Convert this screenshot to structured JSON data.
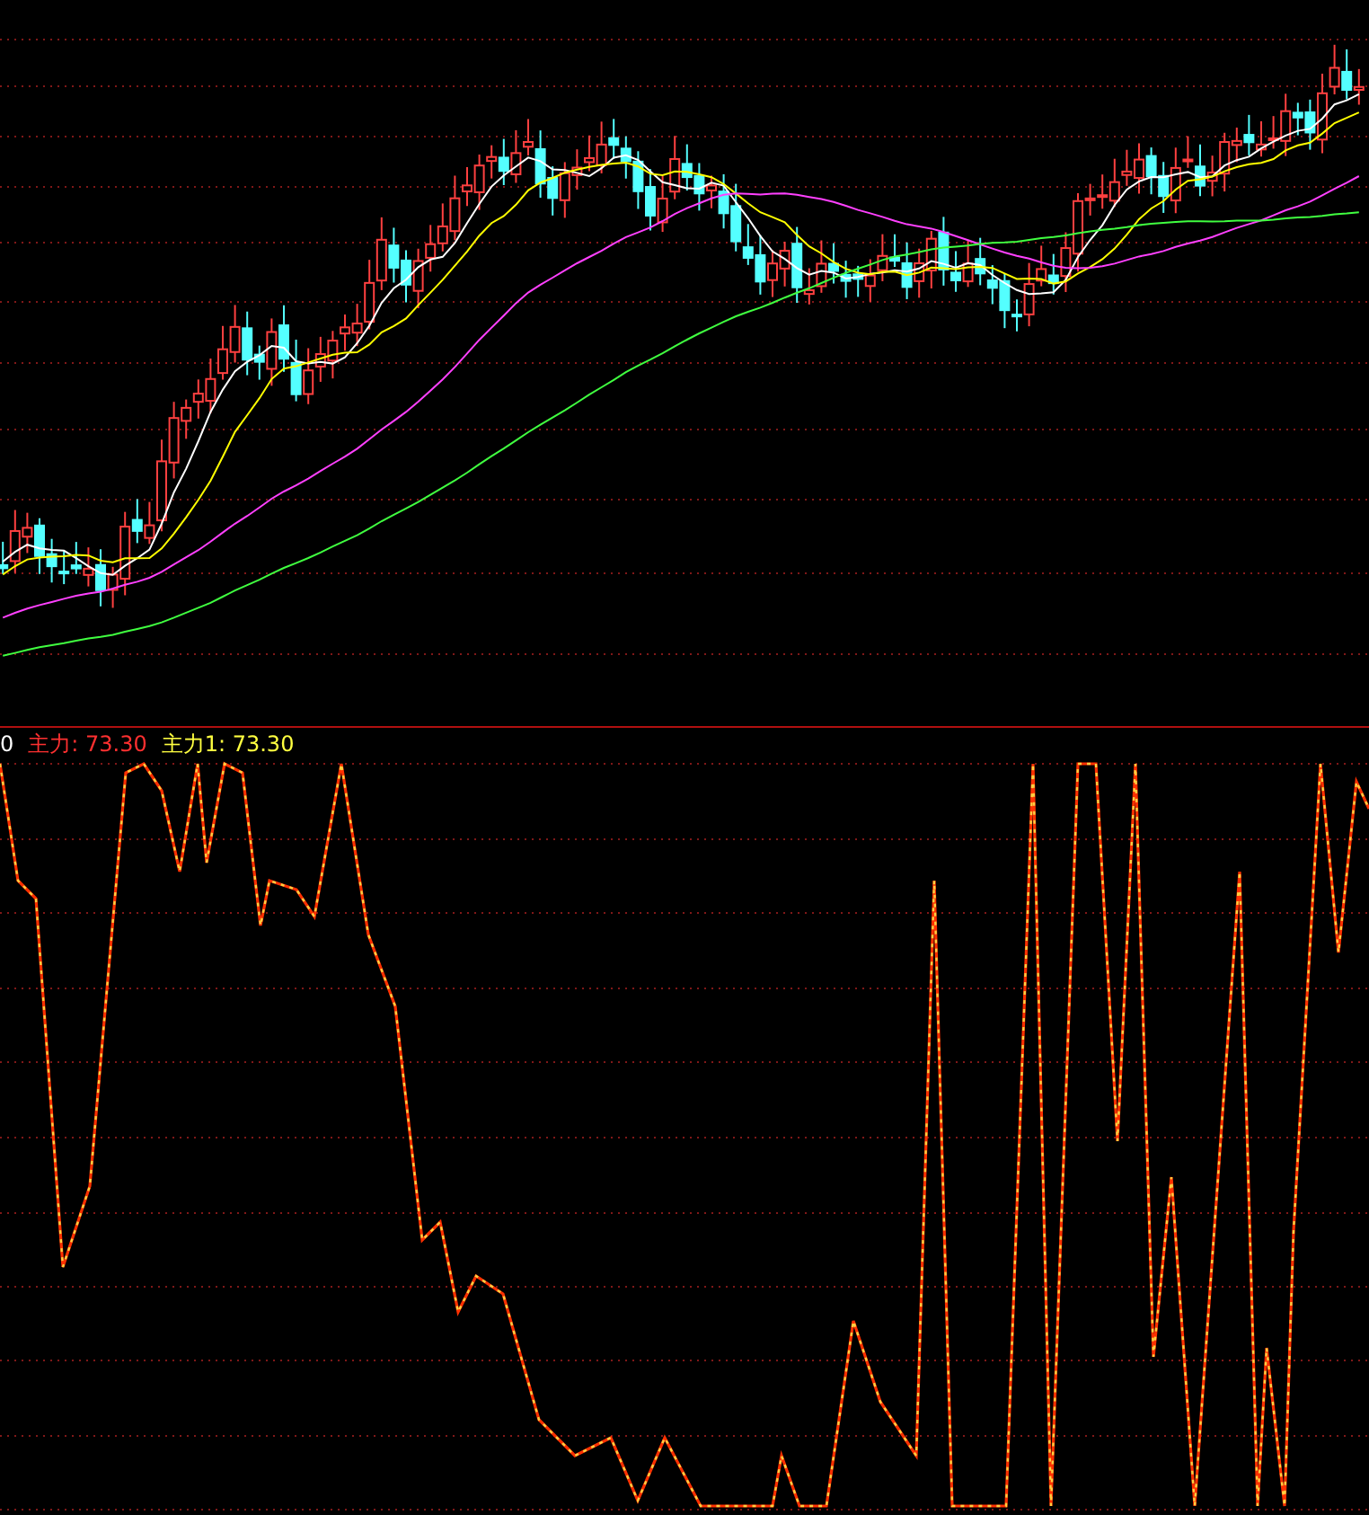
{
  "indicator_legend": [
    {
      "text": "0",
      "color": "#ffffff"
    },
    {
      "text": "主力: 73.30",
      "color": "#ff3030"
    },
    {
      "text": "主力1: 73.30",
      "color": "#ffff40"
    }
  ]
}
